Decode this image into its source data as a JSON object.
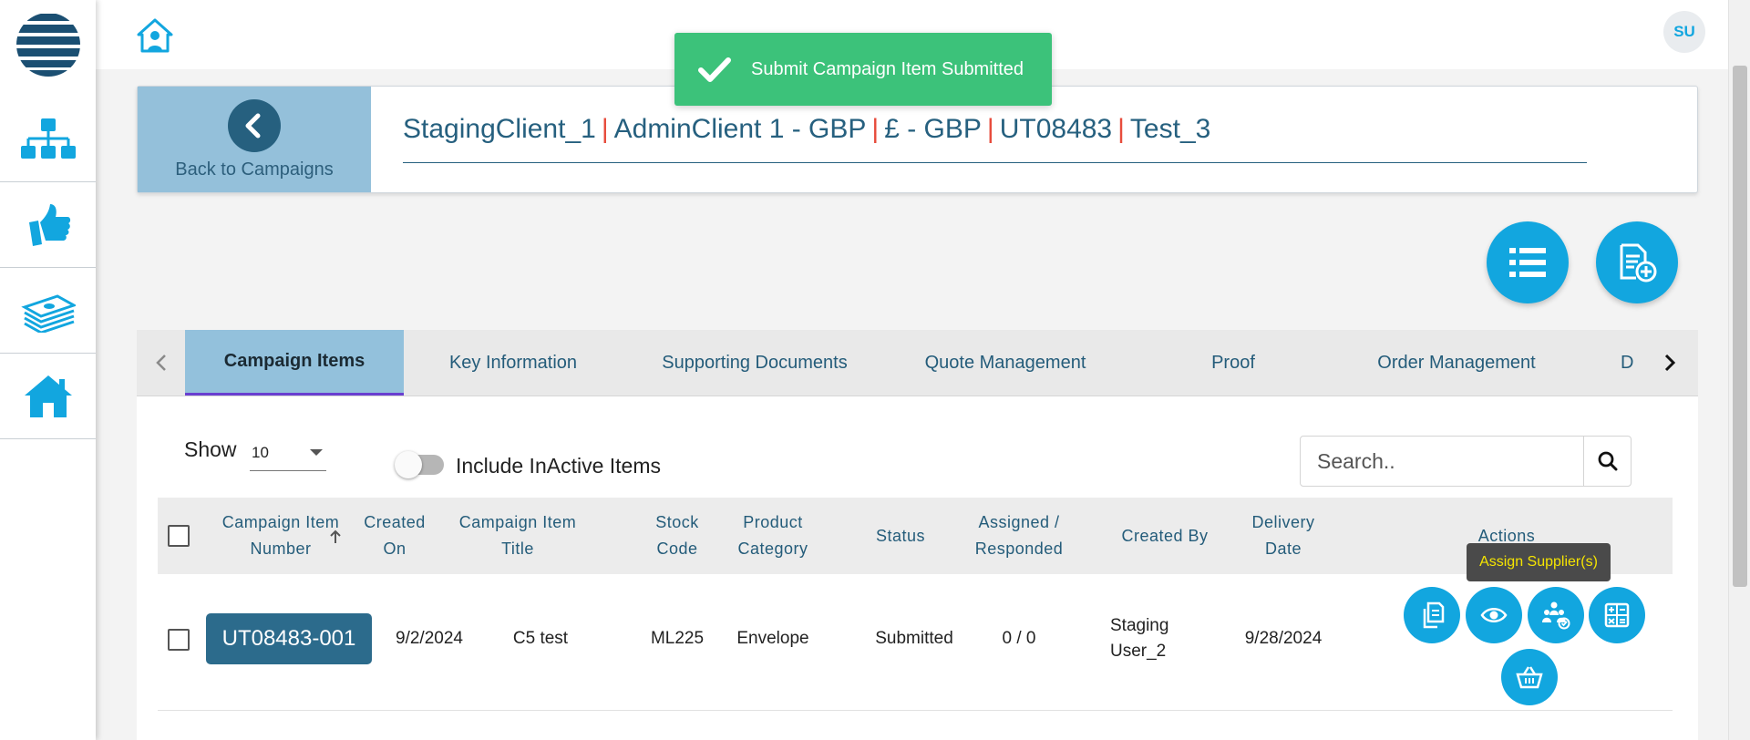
{
  "sidebar": {
    "logo": "globe-logo",
    "items": [
      {
        "icon": "hierarchy-icon"
      },
      {
        "icon": "thumbs-up-icon"
      },
      {
        "icon": "money-stack-icon"
      },
      {
        "icon": "home-icon"
      }
    ]
  },
  "topbar": {
    "home_icon": "home-person-icon",
    "user_initials": "SU"
  },
  "toast": {
    "message": "Submit Campaign Item Submitted",
    "color": "#3cc27a"
  },
  "campaign": {
    "back_label": "Back to Campaigns",
    "breadcrumb": [
      "StagingClient_1",
      "AdminClient 1 - GBP",
      "£ - GBP",
      "UT08483",
      "Test_3"
    ],
    "separator": "|"
  },
  "fabs": [
    {
      "icon": "list-icon"
    },
    {
      "icon": "add-document-icon"
    }
  ],
  "tabs": {
    "items": [
      {
        "label": "Campaign Items",
        "active": true
      },
      {
        "label": "Key Information"
      },
      {
        "label": "Supporting Documents"
      },
      {
        "label": "Quote Management"
      },
      {
        "label": "Proof"
      },
      {
        "label": "Order Management"
      },
      {
        "label": "D"
      }
    ]
  },
  "table": {
    "show_label": "Show",
    "page_size": "10",
    "toggle_label": "Include InActive Items",
    "search_placeholder": "Search..",
    "columns": [
      "Campaign Item Number",
      "Created On",
      "Campaign Item Title",
      "Stock Code",
      "Product Category",
      "Status",
      "Assigned / Responded",
      "Created By",
      "Delivery Date",
      "Actions"
    ],
    "column_lines": {
      "c0": [
        "Campaign Item",
        "Number"
      ],
      "c1": [
        "Created",
        "On"
      ],
      "c2": [
        "Campaign Item",
        "Title"
      ],
      "c3": [
        "Stock",
        "Code"
      ],
      "c4": [
        "Product",
        "Category"
      ],
      "c5": [
        "Status"
      ],
      "c6": [
        "Assigned /",
        "Responded"
      ],
      "c7": [
        "Created By"
      ],
      "c8": [
        "Delivery",
        "Date"
      ],
      "c9": [
        "Actions"
      ]
    },
    "rows": [
      {
        "item_number": "UT08483-001",
        "created_on": "9/2/2024",
        "title": "C5 test",
        "stock_code": "ML225",
        "category": "Envelope",
        "status": "Submitted",
        "assigned_responded": "0 / 0",
        "created_by": [
          "Staging",
          "User_2"
        ],
        "delivery_date": "9/28/2024"
      }
    ],
    "actions": [
      {
        "icon": "copy-icon"
      },
      {
        "icon": "view-eye-icon"
      },
      {
        "icon": "assign-supplier-icon"
      },
      {
        "icon": "calculator-icon"
      },
      {
        "icon": "basket-icon"
      }
    ],
    "tooltip": "Assign Supplier(s)"
  },
  "colors": {
    "primary": "#12a6df",
    "dark_blue": "#26607f",
    "accent_red": "#e74c3c",
    "tab_active": "#93c1dc"
  }
}
